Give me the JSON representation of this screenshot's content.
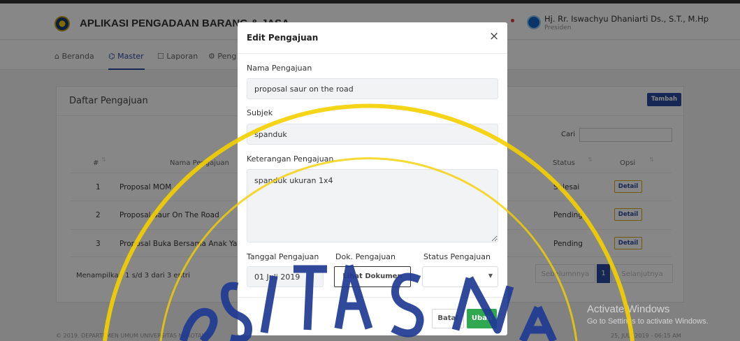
{
  "app": {
    "title": "APLIKASI PENGADAAN BARANG & JASA",
    "user_name": "Hj. Rr. Iswachyu Dhaniarti Ds., S.T., M.Hp",
    "user_role": "Presiden"
  },
  "nav": {
    "beranda": "⌂ Beranda",
    "master": "⌬ Master",
    "laporan": "☐ Laporan",
    "pengaturan": "⚙ Peng"
  },
  "card": {
    "title": "Daftar Pengajuan",
    "add_button": "Tambah",
    "search_label": "Cari",
    "columns": {
      "no": "#",
      "nama": "Nama Pengajuan",
      "status": "Status",
      "opsi": "Opsi"
    },
    "rows": [
      {
        "no": "1",
        "nama": "Proposal MOM",
        "status": "Selesai",
        "detail": "Detail"
      },
      {
        "no": "2",
        "nama": "Proposal Saur On The Road",
        "status": "Pending",
        "detail": "Detail"
      },
      {
        "no": "3",
        "nama": "Proposal Buka Bersama Anak Ya",
        "status": "Pending",
        "detail": "Detail"
      }
    ],
    "info": "Menampilkan 1 s/d 3 dari 3 entri",
    "pagination": {
      "prev": "Sebelumnnya",
      "page": "1",
      "next": "Selanjutnya"
    }
  },
  "footer": {
    "left": "© 2019. DEPARTEMEN UMUM UNIVERSITAS NAROTAMA",
    "right": "25, JULY 2019 - 06:15 AM"
  },
  "windows": {
    "title": "Activate Windows",
    "subtitle": "Go to Settings to activate Windows."
  },
  "modal": {
    "title": "Edit Pengajuan",
    "close": "×",
    "nama_label": "Nama Pengajuan",
    "nama_value": "proposal saur on the road",
    "subjek_label": "Subjek",
    "subjek_value": "spanduk",
    "keterangan_label": "Keterangan Pengajuan",
    "keterangan_value": "spanduk ukuran 1x4",
    "tanggal_label": "Tanggal Pengajuan",
    "tanggal_value": "01 Juli 2019",
    "dok_label": "Dok. Pengajuan",
    "dok_button": "Lihat Dokumen",
    "status_label": "Status Pengajuan",
    "status_value": "",
    "cancel_button": "Batal",
    "submit_button": "Ubah"
  },
  "colors": {
    "brand": "#2c4aa1",
    "success": "#2fa84f",
    "watermark": "#f5d000"
  },
  "icons": {
    "logo": "university-logo-icon",
    "notification": "bell-icon",
    "avatar": "user-avatar-icon",
    "close": "close-icon",
    "select": "caret-down-icon"
  }
}
